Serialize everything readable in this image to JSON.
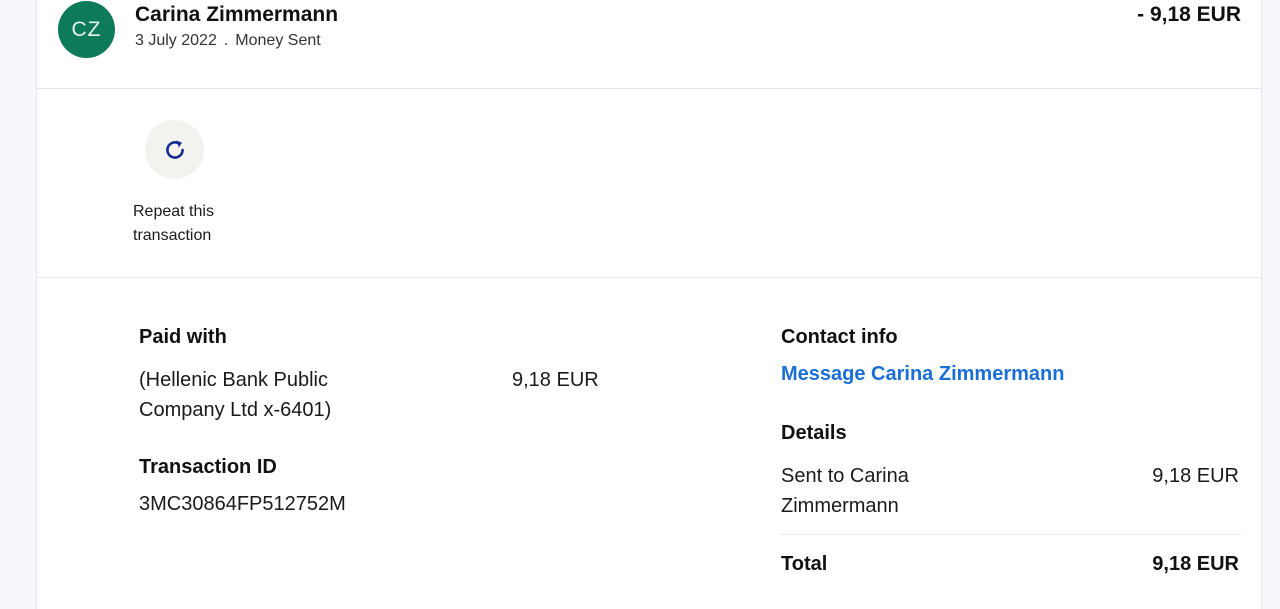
{
  "header": {
    "avatar_initials": "CZ",
    "name": "Carina Zimmermann",
    "date": "3 July 2022",
    "separator": ".",
    "type": "Money Sent",
    "amount": "- 9,18 EUR"
  },
  "actions": {
    "repeat_icon": "refresh-icon",
    "repeat_label": "Repeat this transaction"
  },
  "paid_with": {
    "heading": "Paid with",
    "source": "(Hellenic Bank Public Company Ltd x-6401)",
    "amount": "9,18 EUR"
  },
  "transaction": {
    "heading": "Transaction ID",
    "id": "3MC30864FP512752M"
  },
  "contact": {
    "heading": "Contact info",
    "message_link": "Message Carina Zimmermann"
  },
  "details": {
    "heading": "Details",
    "sent_to": "Sent to Carina Zimmermann",
    "sent_amount": "9,18 EUR",
    "total_label": "Total",
    "total_amount": "9,18 EUR"
  },
  "colors": {
    "avatar_bg": "#0d7a5a",
    "link": "#1a6fd6"
  }
}
